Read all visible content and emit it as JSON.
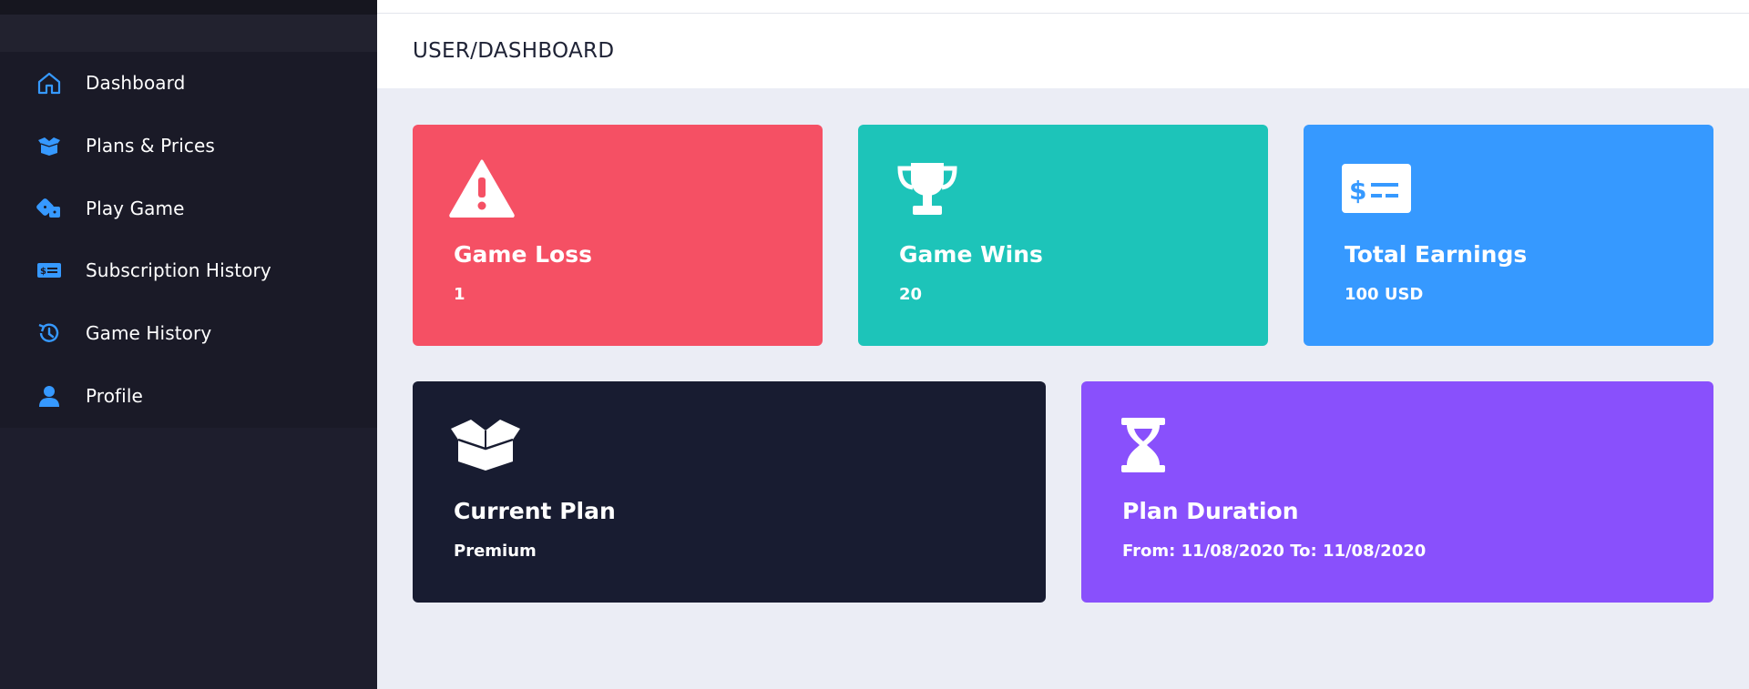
{
  "sidebar": {
    "items": [
      {
        "label": "Dashboard",
        "icon": "home-icon"
      },
      {
        "label": "Plans & Prices",
        "icon": "box-open-icon"
      },
      {
        "label": "Play Game",
        "icon": "dice-icon"
      },
      {
        "label": "Subscription History",
        "icon": "money-check-icon"
      },
      {
        "label": "Game History",
        "icon": "history-icon"
      },
      {
        "label": "Profile",
        "icon": "user-icon"
      }
    ]
  },
  "header": {
    "title": "USER/DASHBOARD"
  },
  "cards": {
    "loss": {
      "title": "Game Loss",
      "value": "1",
      "icon": "warning-icon",
      "color": "#f55064"
    },
    "wins": {
      "title": "Game Wins",
      "value": "20",
      "icon": "trophy-icon",
      "color": "#1dc4b9"
    },
    "earnings": {
      "title": "Total Earnings",
      "value": "100 USD",
      "icon": "money-check-icon",
      "color": "#3699ff"
    },
    "plan": {
      "title": "Current Plan",
      "value": "Premium",
      "icon": "box-open-icon",
      "color": "#181c31"
    },
    "duration": {
      "title": "Plan Duration",
      "value": "From: 11/08/2020 To: 11/08/2020",
      "icon": "hourglass-icon",
      "color": "#8950fc"
    }
  },
  "colors": {
    "accent": "#3699ff",
    "sidebar_bg": "#1e1e2d"
  }
}
